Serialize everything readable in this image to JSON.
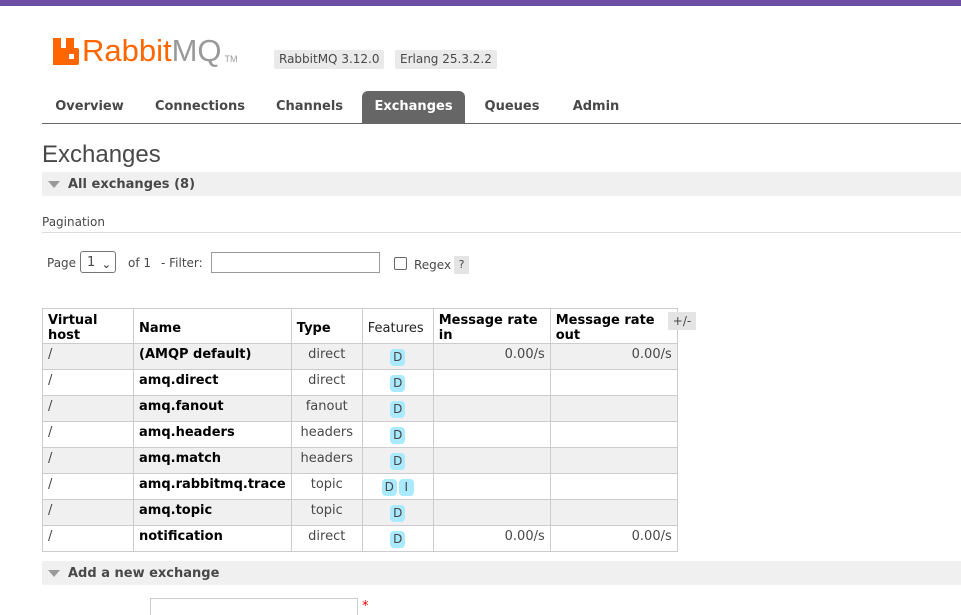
{
  "header": {
    "logo_rabbit": "Rabbit",
    "logo_mq": "MQ",
    "logo_tm": "TM",
    "version": "RabbitMQ 3.12.0",
    "erlang": "Erlang 25.3.2.2"
  },
  "tabs": [
    {
      "label": "Overview",
      "active": false
    },
    {
      "label": "Connections",
      "active": false
    },
    {
      "label": "Channels",
      "active": false
    },
    {
      "label": "Exchanges",
      "active": true
    },
    {
      "label": "Queues",
      "active": false
    },
    {
      "label": "Admin",
      "active": false
    }
  ],
  "page_title": "Exchanges",
  "all_exchanges": "All exchanges (8)",
  "pagination": {
    "label": "Pagination",
    "page_text": "Page",
    "page_value": "1",
    "of_text": "of 1",
    "filter_text": "- Filter:",
    "filter_value": "",
    "regex_label": "Regex",
    "help": "?"
  },
  "table": {
    "columns": [
      "Virtual host",
      "Name",
      "Type",
      "Features",
      "Message rate in",
      "Message rate out"
    ],
    "toggle": "+/-",
    "rows": [
      {
        "vhost": "/",
        "name": "(AMQP default)",
        "type": "direct",
        "features": [
          "D"
        ],
        "rate_in": "0.00/s",
        "rate_out": "0.00/s"
      },
      {
        "vhost": "/",
        "name": "amq.direct",
        "type": "direct",
        "features": [
          "D"
        ],
        "rate_in": "",
        "rate_out": ""
      },
      {
        "vhost": "/",
        "name": "amq.fanout",
        "type": "fanout",
        "features": [
          "D"
        ],
        "rate_in": "",
        "rate_out": ""
      },
      {
        "vhost": "/",
        "name": "amq.headers",
        "type": "headers",
        "features": [
          "D"
        ],
        "rate_in": "",
        "rate_out": ""
      },
      {
        "vhost": "/",
        "name": "amq.match",
        "type": "headers",
        "features": [
          "D"
        ],
        "rate_in": "",
        "rate_out": ""
      },
      {
        "vhost": "/",
        "name": "amq.rabbitmq.trace",
        "type": "topic",
        "features": [
          "D",
          "I"
        ],
        "rate_in": "",
        "rate_out": ""
      },
      {
        "vhost": "/",
        "name": "amq.topic",
        "type": "topic",
        "features": [
          "D"
        ],
        "rate_in": "",
        "rate_out": ""
      },
      {
        "vhost": "/",
        "name": "notification",
        "type": "direct",
        "features": [
          "D"
        ],
        "rate_in": "0.00/s",
        "rate_out": "0.00/s"
      }
    ]
  },
  "add_exchange": "Add a new exchange",
  "required_mark": "*",
  "colors": {
    "brand": "#ff6600",
    "topbar": "#6c4fa5",
    "active_tab": "#666666",
    "badge": "#aaeaff"
  }
}
